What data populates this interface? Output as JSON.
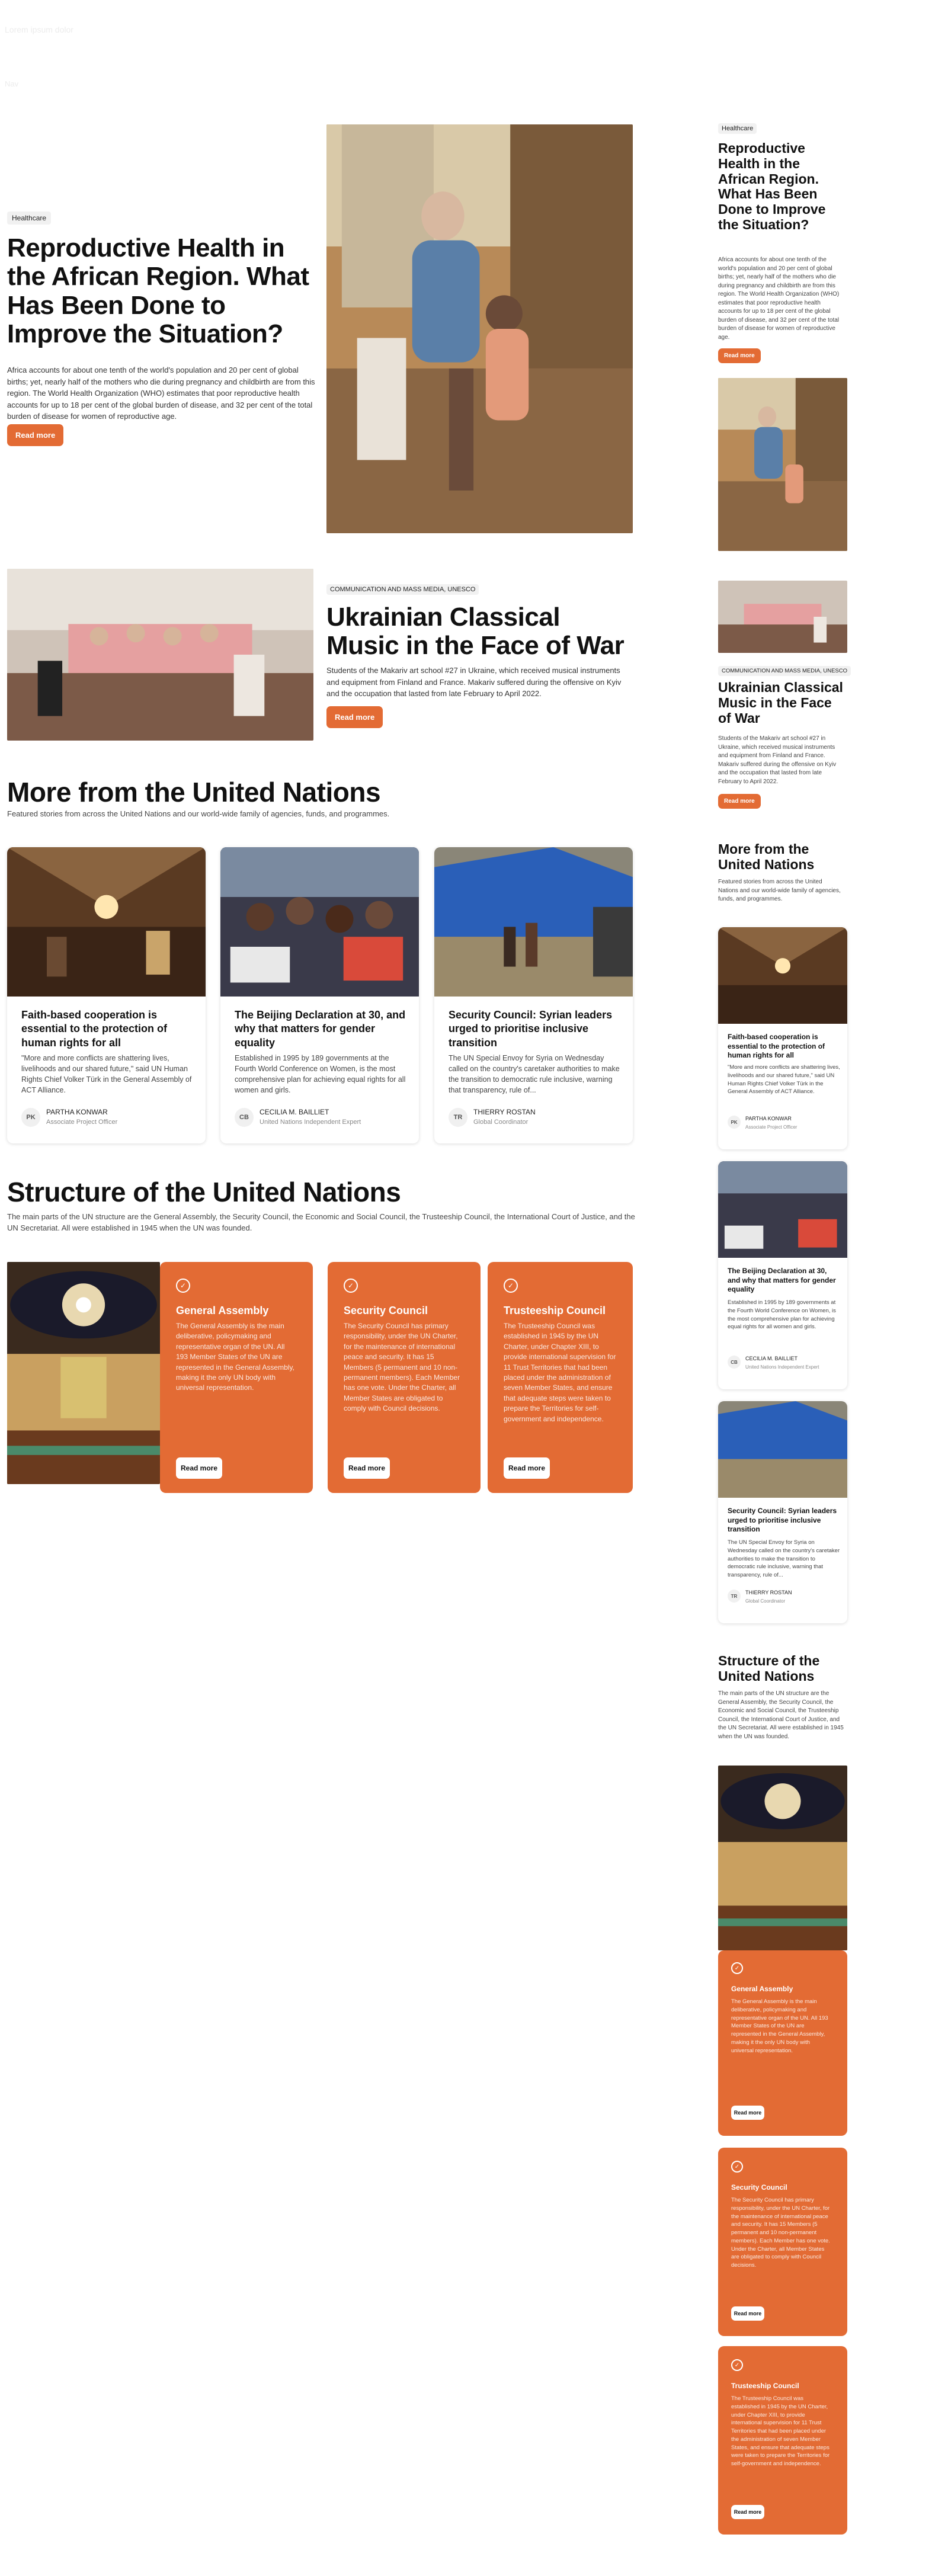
{
  "faint_lines": [
    "Lorem ipsum dolor",
    "Nav"
  ],
  "hero": {
    "tag": "Healthcare",
    "title": "Reproductive Health in the African Region. What Has Been Done to Improve the Situation?",
    "body": "Africa accounts for about one tenth of the world's population and 20 per cent of global births; yet, nearly half of the mothers who die during pregnancy and childbirth are from this region. The World Health Organization (WHO) estimates that poor reproductive health accounts for up to 18 per cent of the global burden of disease, and 32 per cent of the total burden of disease for women of reproductive age.",
    "button": "Read more"
  },
  "feature": {
    "tag": "COMMUNICATION AND MASS MEDIA, UNESCO",
    "title": "Ukrainian Classical Music in the Face of War",
    "body": "Students of the Makariv art school #27 in Ukraine, which received musical instruments and equipment from Finland and France. Makariv suffered during the offensive on Kyiv and the occupation that lasted from late February to April 2022.",
    "button": "Read more"
  },
  "more": {
    "title": "More from the United Nations",
    "subtitle": "Featured stories from across the United Nations and our world-wide family of agencies, funds, and programmes.",
    "cards": [
      {
        "title": "Faith-based cooperation is essential to the protection of human rights for all",
        "body": "\"More and more conflicts are shattering lives, livelihoods and our shared future,\" said UN Human Rights Chief Volker Türk in the General Assembly of ACT Alliance.",
        "initials": "PK",
        "author": "PARTHA KONWAR",
        "role": "Associate Project Officer"
      },
      {
        "title": "The Beijing Declaration at 30, and why that matters for gender equality",
        "body": "Established in 1995 by 189 governments at the Fourth World Conference on Women, is the most comprehensive plan for achieving equal rights for all women and girls.",
        "initials": "CB",
        "author": "CECILIA M. BAILLIET",
        "role": "United Nations Independent Expert"
      },
      {
        "title": "Security Council: Syrian leaders urged to prioritise inclusive transition",
        "body": "The UN Special Envoy for Syria on Wednesday called on the country's caretaker authorities to make the transition to democratic rule inclusive, warning that transparency, rule of...",
        "initials": "TR",
        "author": "THIERRY ROSTAN",
        "role": "Global Coordinator"
      }
    ]
  },
  "structure": {
    "title": "Structure of the United Nations",
    "subtitle": "The main parts of the UN structure are the General Assembly, the Security Council, the Economic and Social Council, the Trusteeship Council, the International Court of Justice, and the UN Secretariat. All were established in 1945 when the UN was founded.",
    "organs": [
      {
        "title": "General Assembly",
        "body": "The General Assembly is the main deliberative, policymaking and representative organ of the UN. All 193 Member States of the UN are represented in the General Assembly, making it the only UN body with universal representation.",
        "button": "Read more"
      },
      {
        "title": "Security Council",
        "body": "The Security Council has primary responsibility, under the UN Charter, for the maintenance of international peace and security. It has 15 Members (5 permanent and 10 non-permanent members). Each Member has one vote. Under the Charter, all Member States are obligated to comply with Council decisions.",
        "button": "Read more"
      },
      {
        "title": "Trusteeship Council",
        "body": "The Trusteeship Council was established in 1945 by the UN Charter, under Chapter XIII, to provide international supervision for 11 Trust Territories that had been placed under the administration of seven Member States, and ensure that adequate steps were taken to prepare the Territories for self-government and independence.",
        "button": "Read more"
      }
    ]
  },
  "colors": {
    "accent": "#e36b34",
    "tag_bg": "#f1f1f1"
  },
  "icons": {
    "organ": "check-circle-icon"
  }
}
